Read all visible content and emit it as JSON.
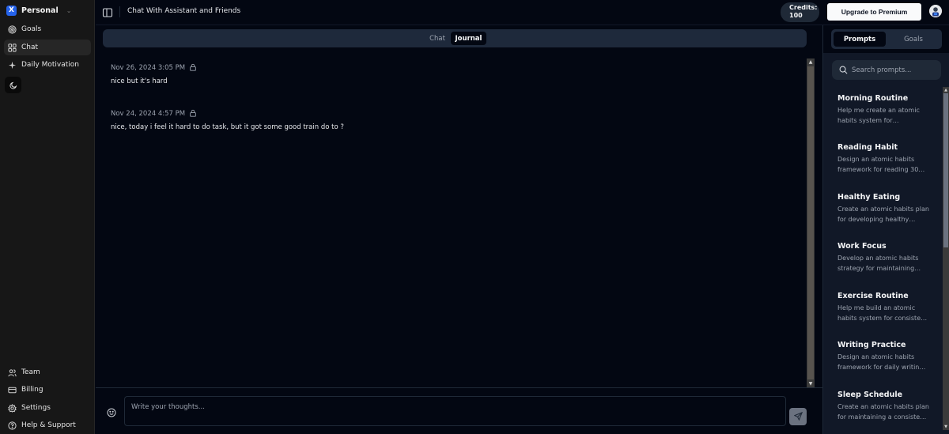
{
  "sidebar": {
    "workspace": {
      "logo": "X",
      "name": "Personal"
    },
    "top_items": [
      {
        "label": "Goals",
        "icon": "target-icon",
        "active": false
      },
      {
        "label": "Chat",
        "icon": "grid-icon",
        "active": true
      },
      {
        "label": "Daily Motivation",
        "icon": "sparkles-icon",
        "active": false
      }
    ],
    "bottom_items": [
      {
        "label": "Team",
        "icon": "users-icon"
      },
      {
        "label": "Billing",
        "icon": "credit-card-icon"
      },
      {
        "label": "Settings",
        "icon": "gear-icon"
      },
      {
        "label": "Help & Support",
        "icon": "help-circle-icon"
      }
    ]
  },
  "header": {
    "title": "Chat With Assistant and Friends",
    "credits_label": "Credits:",
    "credits_value": "100",
    "upgrade_label": "Upgrade to Premium"
  },
  "main": {
    "tabs": [
      {
        "label": "Chat",
        "active": false
      },
      {
        "label": "Journal",
        "active": true
      }
    ],
    "entries": [
      {
        "date": "Nov 26, 2024 3:05 PM",
        "text": "nice but it's hard",
        "locked": true
      },
      {
        "date": "Nov 24, 2024 4:57 PM",
        "text": "nice, today i feel it hard to do task, but it got some good train do to ?",
        "locked": true
      }
    ],
    "composer": {
      "placeholder": "Write your thoughts...",
      "value": ""
    }
  },
  "right_panel": {
    "tabs": [
      {
        "label": "Prompts",
        "active": true
      },
      {
        "label": "Goals",
        "active": false
      }
    ],
    "search_placeholder": "Search prompts...",
    "prompts": [
      {
        "title": "Morning Routine",
        "description": "Help me create an atomic habits system for…"
      },
      {
        "title": "Reading Habit",
        "description": "Design an atomic habits framework for reading 30…"
      },
      {
        "title": "Healthy Eating",
        "description": "Create an atomic habits plan for developing healthy…"
      },
      {
        "title": "Work Focus",
        "description": "Develop an atomic habits strategy for maintaining…"
      },
      {
        "title": "Exercise Routine",
        "description": "Help me build an atomic habits system for consiste…"
      },
      {
        "title": "Writing Practice",
        "description": "Design an atomic habits framework for daily writin…"
      },
      {
        "title": "Sleep Schedule",
        "description": "Create an atomic habits plan for maintaining a consiste…"
      }
    ]
  },
  "colors": {
    "background": "#030712",
    "sidebar": "#171717",
    "panel": "#111827",
    "tabbar": "#1e293b",
    "workspace_logo": "#2563eb"
  }
}
